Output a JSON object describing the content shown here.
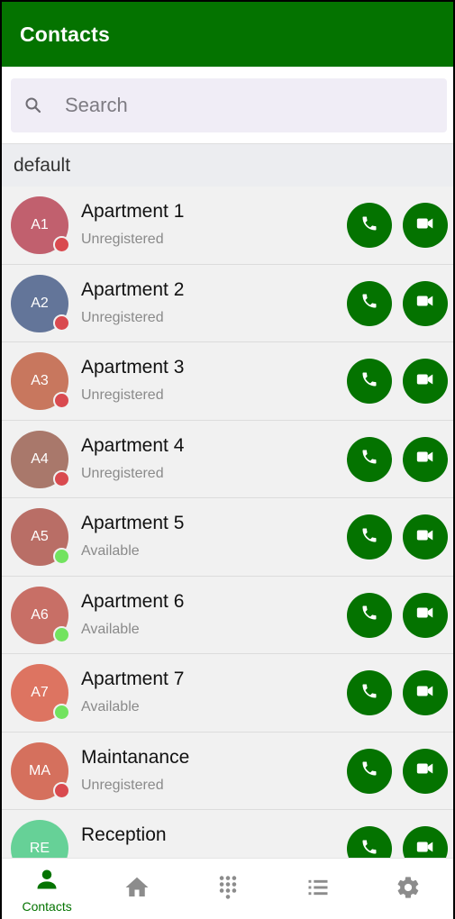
{
  "appbar": {
    "title": "Contacts"
  },
  "search": {
    "placeholder": "Search",
    "icon": "search-icon"
  },
  "group": {
    "label": "default"
  },
  "colors": {
    "brand": "#047300",
    "registered_dot": "#72e35f",
    "unregistered_dot": "#d94a4f"
  },
  "contacts": [
    {
      "initials": "A1",
      "name": "Apartment 1",
      "status": "Unregistered",
      "avatar_color": "#c1606e",
      "state": "unregistered"
    },
    {
      "initials": "A2",
      "name": "Apartment 2",
      "status": "Unregistered",
      "avatar_color": "#637599",
      "state": "unregistered"
    },
    {
      "initials": "A3",
      "name": "Apartment 3",
      "status": "Unregistered",
      "avatar_color": "#c8775e",
      "state": "unregistered"
    },
    {
      "initials": "A4",
      "name": "Apartment 4",
      "status": "Unregistered",
      "avatar_color": "#a9786b",
      "state": "unregistered"
    },
    {
      "initials": "A5",
      "name": "Apartment 5",
      "status": "Available",
      "avatar_color": "#b96e66",
      "state": "available"
    },
    {
      "initials": "A6",
      "name": "Apartment 6",
      "status": "Available",
      "avatar_color": "#c86f66",
      "state": "available"
    },
    {
      "initials": "A7",
      "name": "Apartment 7",
      "status": "Available",
      "avatar_color": "#dd7461",
      "state": "available"
    },
    {
      "initials": "MA",
      "name": "Maintanance",
      "status": "Unregistered",
      "avatar_color": "#d5705d",
      "state": "unregistered"
    },
    {
      "initials": "RE",
      "name": "Reception",
      "status": "",
      "avatar_color": "#66d197",
      "state": "none"
    }
  ],
  "bottom_nav": [
    {
      "label": "Contacts",
      "icon": "person-icon",
      "active": true
    },
    {
      "label": "",
      "icon": "home-icon",
      "active": false
    },
    {
      "label": "",
      "icon": "dialpad-icon",
      "active": false
    },
    {
      "label": "",
      "icon": "list-icon",
      "active": false
    },
    {
      "label": "",
      "icon": "gear-icon",
      "active": false
    }
  ]
}
